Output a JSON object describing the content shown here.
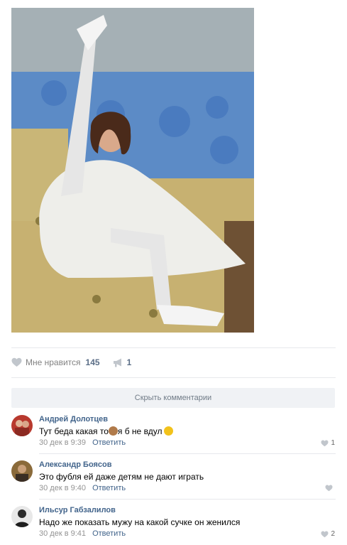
{
  "post": {
    "photo_alt": ""
  },
  "actions": {
    "like_label": "Мне нравится",
    "like_count": "145",
    "share_count": "1"
  },
  "comments_toggle": "Скрыть комментарии",
  "comments": [
    {
      "author": "Андрей Долотцев",
      "text_before": "Тут беда какая то",
      "text_middle": "я б не вдул",
      "date": "30 дек в 9:39",
      "reply": "Ответить",
      "likes": "1"
    },
    {
      "author": "Александр Боясов",
      "text": "Это фубля ей даже детям не дают играть",
      "date": "30 дек в 9:40",
      "reply": "Ответить",
      "likes": ""
    },
    {
      "author": "Ильсур Габзалилов",
      "text": "Надо же показать мужу на какой сучке он женился",
      "date": "30 дек в 9:41",
      "reply": "Ответить",
      "likes": "2"
    }
  ],
  "colors": {
    "link": "#42648b",
    "muted": "#939393",
    "button_bg": "#f0f2f5",
    "separator": "#e7e8ec"
  },
  "icons": {
    "like": "heart-icon",
    "share": "megaphone-icon",
    "emoji_monkey": "see-no-evil-monkey-emoji",
    "emoji_smile": "grinning-face-emoji"
  }
}
